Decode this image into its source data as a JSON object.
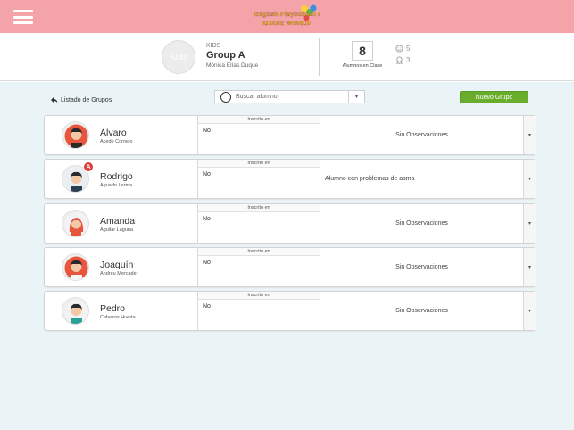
{
  "header": {
    "logo_text": "English PlaySchool & KIDDIE WORLD"
  },
  "group": {
    "avatar_label": "Kids",
    "kind": "KIDS",
    "name": "Group A",
    "teacher": "Mónica Elías Duque",
    "students_count": "8",
    "students_label": "Alumnos en Clase",
    "stat_one": "5",
    "stat_two": "3"
  },
  "toolbar": {
    "back_label": "Listado de Grupos",
    "search_placeholder": "Buscar alumno",
    "new_group_label": "Nuevo Grupo"
  },
  "students": [
    {
      "name": "Álvaro",
      "surname": "Acedo Cornejo",
      "inscrito_header": "Inscrito en",
      "inscrito_value": "No",
      "observations": "Sin Observaciones"
    },
    {
      "name": "Rodrigo",
      "surname": "Aguado Lerma",
      "inscrito_header": "Inscrito en",
      "inscrito_value": "No",
      "observations": "Alumno con problemas de asma",
      "badge": "A"
    },
    {
      "name": "Amanda",
      "surname": "Aguilar Laguna",
      "inscrito_header": "Inscrito en",
      "inscrito_value": "No",
      "observations": "Sin Observaciones"
    },
    {
      "name": "Joaquín",
      "surname": "Andreu Mercader",
      "inscrito_header": "Inscrito en",
      "inscrito_value": "No",
      "observations": "Sin Observaciones"
    },
    {
      "name": "Pedro",
      "surname": "Cabezas Huerta",
      "inscrito_header": "Inscrito en",
      "inscrito_value": "No",
      "observations": "Sin Observaciones"
    }
  ],
  "icons": {
    "menu": "hamburger-icon",
    "back": "back-arrow-icon",
    "search": "search-icon",
    "dropdown": "chevron-down-icon",
    "stat_one": "face-icon",
    "stat_two": "ribbon-icon"
  },
  "colors": {
    "topbar": "#f4a3a8",
    "background": "#eaf3f5",
    "primary_button": "#6aad2c",
    "alert_badge": "#e03b3b"
  }
}
